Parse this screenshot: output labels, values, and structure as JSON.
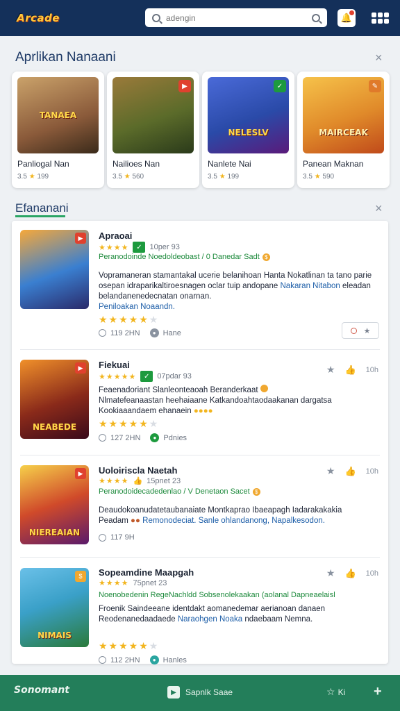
{
  "header": {
    "logo_text": "Arcade",
    "search_placeholder": "adengin",
    "notif_icon": "bell-icon",
    "grid_icon": "grid-icon"
  },
  "section_featured": {
    "title": "Aprlikan Nanaani",
    "close_label": "×"
  },
  "featured": [
    {
      "name": "Panliogal Nan",
      "rating": "3.5",
      "downloads": "199",
      "art_label": "TANAEA",
      "art_color": "#8a5a3a",
      "badge_color": "#e0412e"
    },
    {
      "name": "Nailioes Nan",
      "rating": "3.5",
      "downloads": "560",
      "art_label": "",
      "art_color": "#5b6b2a",
      "badge_color": "#e0412e"
    },
    {
      "name": "Nanlete Nai",
      "rating": "3.5",
      "downloads": "199",
      "art_label": "NELESLV",
      "art_color": "#2a4aa8",
      "badge_color": "#1d9a3e"
    },
    {
      "name": "Panean Maknan",
      "rating": "3.5",
      "downloads": "590",
      "art_label": "MAIRCEAK",
      "art_color": "#e08a2a",
      "badge_color": "#e07a2a"
    }
  ],
  "section_list": {
    "title": "Efananani",
    "close_label": "×"
  },
  "list": [
    {
      "title": "Apraoai",
      "rating_text": "10per 93",
      "tags": "Peranodoinde Noedoldeobast / 0 Danedar Sadt",
      "desc": "Vopramaneran stamantakal ucerie belanihoan Hanta Nokatlinan ta tano parie osepan idraparikaltiroesnagen oclar tuip andopane",
      "desc_hl": "Nakaran Nitabon",
      "desc2": "eleadan belandanenedecnatan onarnan.",
      "desc3": "Peniloakan Noaandn.",
      "downloads": "119 2HN",
      "platform": "Hane",
      "thumb_label": "",
      "thumb_color": "#3a7fd0"
    },
    {
      "title": "Fiekuai",
      "rating_text": "07pdar 93",
      "tags": "",
      "desc": "Feaenadoriant Slanleonteaoah Beranderkaat",
      "desc2": "Nlmatefeanaastan heehaiaane Katkandoahtaodaakanan dargatsa",
      "desc3": "Kookiaaandaem ehanaein",
      "downloads": "127 2HN",
      "platform": "Pdnies",
      "thumb_label": "NEABEDE",
      "thumb_color": "#8a2a1a",
      "action_count": "10h"
    },
    {
      "title": "Uoloiriscla Naetah",
      "rating_text": "15pnet 23",
      "tags": "Peranodoidecadedenlao / V Denetaon Sacet",
      "desc": "Deaudokoanudatetaubanaiate Montkaprao Ibaeapagh Iadarakakakia",
      "desc_hl": "Remonodeciat. Sanle ohlandanong, Napalkesodon.",
      "desc2": "Peadam",
      "downloads": "117 9H",
      "platform": "",
      "thumb_label": "NIEREAIAN",
      "thumb_color": "#d04a2a",
      "action_count": "10h"
    },
    {
      "title": "Sopeamdine Maapgah",
      "rating_text": "75pnet 23",
      "tags": "Noenobedenin RegeNachldd Sobsenolekaakan (aolanal Dapneaelaisl",
      "desc": "Froenik Saindeeane identdakt aomanedemar aerianoan danaen",
      "desc2": "Reodenanedaadaede",
      "desc_hl": "Naraohgen Noaka",
      "desc3": "ndaebaam Nemna.",
      "downloads": "112 2HN",
      "platform": "Hanles",
      "thumb_label": "NIMAIS",
      "thumb_color": "#3aa0c8",
      "action_count": "10h"
    }
  ],
  "bottom": {
    "logo_text": "Sonomant",
    "center_label": "Sapnlk Saae",
    "right_label": "Ki",
    "plus_label": "+"
  }
}
